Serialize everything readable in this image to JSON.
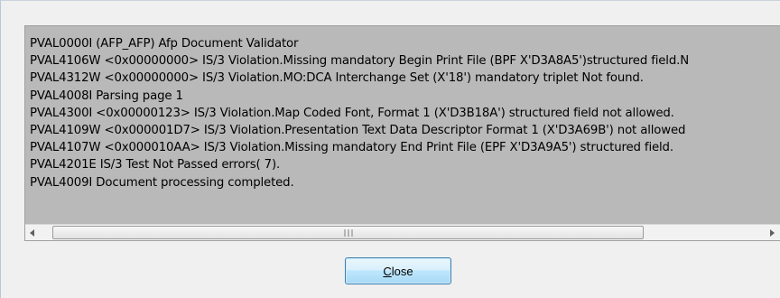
{
  "log": {
    "lines": [
      "PVAL0000I (AFP_AFP) Afp Document Validator",
      "PVAL4106W <0x00000000>  IS/3 Violation.Missing mandatory Begin Print File (BPF X'D3A8A5')structured field.N",
      "PVAL4312W <0x00000000>  IS/3 Violation.MO:DCA Interchange Set (X'18') mandatory triplet Not found.",
      "PVAL4008I Parsing page 1",
      "PVAL4300I <0x00000123>  IS/3 Violation.Map Coded Font, Format 1 (X'D3B18A') structured field not allowed.",
      "PVAL4109W <0x000001D7>  IS/3 Violation.Presentation Text Data Descriptor Format 1 (X'D3A69B') not allowed",
      "PVAL4107W <0x000010AA>  IS/3 Violation.Missing mandatory End Print File (EPF X'D3A9A5')  structured field.",
      "PVAL4201E IS/3 Test Not Passed errors( 7).",
      "PVAL4009I Document processing completed."
    ]
  },
  "scrollbar": {
    "left_icon": "scroll-left-arrow",
    "right_icon": "scroll-right-arrow",
    "grip_icon": "scroll-grip"
  },
  "footer": {
    "close_mnemonic": "C",
    "close_rest": "lose"
  }
}
